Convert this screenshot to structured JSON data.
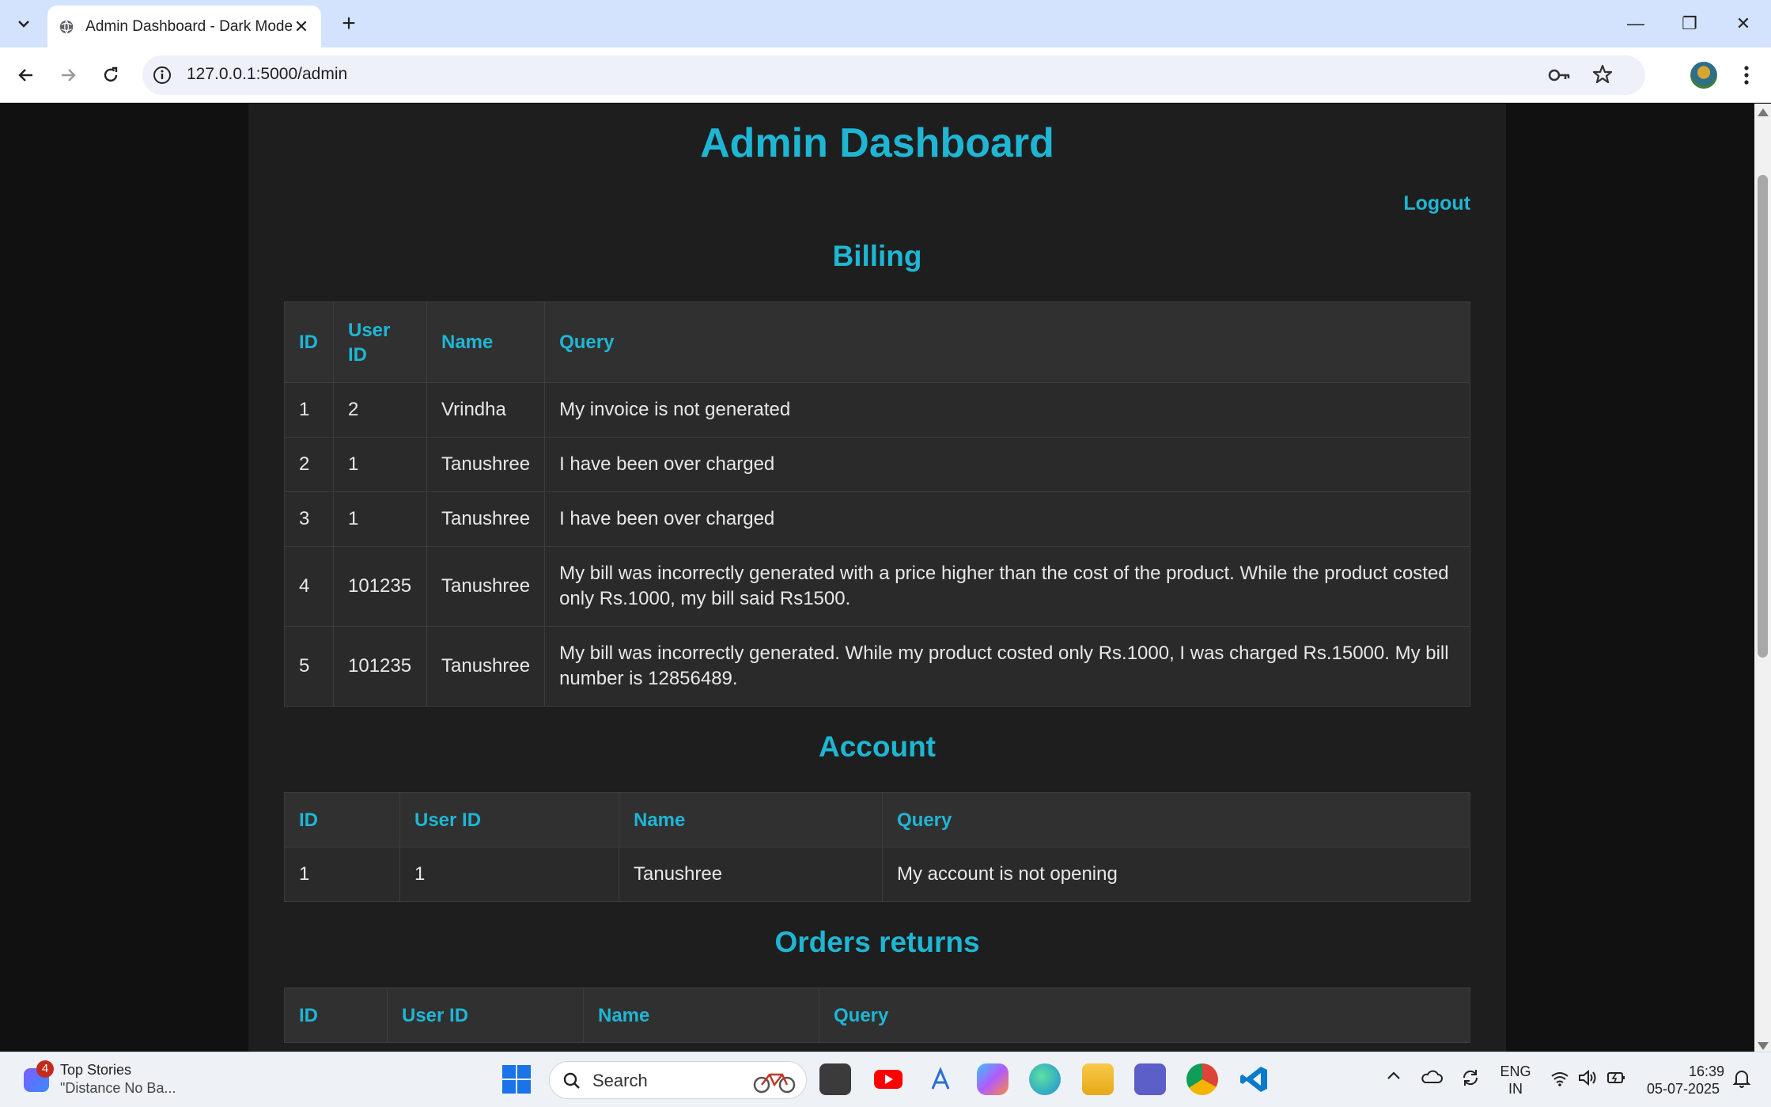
{
  "browser": {
    "tab_title": "Admin Dashboard - Dark Mode",
    "tab_close": "✕",
    "new_tab": "+",
    "url": "127.0.0.1:5000/admin",
    "minimize": "—",
    "restore": "❐",
    "close": "✕"
  },
  "page": {
    "title": "Admin Dashboard",
    "logout_label": "Logout",
    "accent_color": "#1fb6d4"
  },
  "billing": {
    "title": "Billing",
    "headers": [
      "ID",
      "User ID",
      "Name",
      "Query"
    ],
    "rows": [
      [
        "1",
        "2",
        "Vrindha",
        "My invoice is not generated"
      ],
      [
        "2",
        "1",
        "Tanushree",
        "I have been over charged"
      ],
      [
        "3",
        "1",
        "Tanushree",
        "I have been over charged"
      ],
      [
        "4",
        "101235",
        "Tanushree",
        "My bill was incorrectly generated with a price higher than the cost of the product. While the product costed only Rs.1000, my bill said Rs1500."
      ],
      [
        "5",
        "101235",
        "Tanushree",
        "My bill was incorrectly generated. While my product costed only Rs.1000, I was charged Rs.15000. My bill number is 12856489."
      ]
    ]
  },
  "account": {
    "title": "Account",
    "headers": [
      "ID",
      "User ID",
      "Name",
      "Query"
    ],
    "rows": [
      [
        "1",
        "1",
        "Tanushree",
        "My account is not opening"
      ]
    ]
  },
  "orders_returns": {
    "title": "Orders returns",
    "headers": [
      "ID",
      "User ID",
      "Name",
      "Query"
    ]
  },
  "taskbar": {
    "news_badge": "4",
    "news_title": "Top Stories",
    "news_subtitle": "\"Distance No Ba...",
    "search_label": "Search",
    "lang_line1": "ENG",
    "lang_line2": "IN",
    "time": "16:39",
    "date": "05-07-2025"
  }
}
